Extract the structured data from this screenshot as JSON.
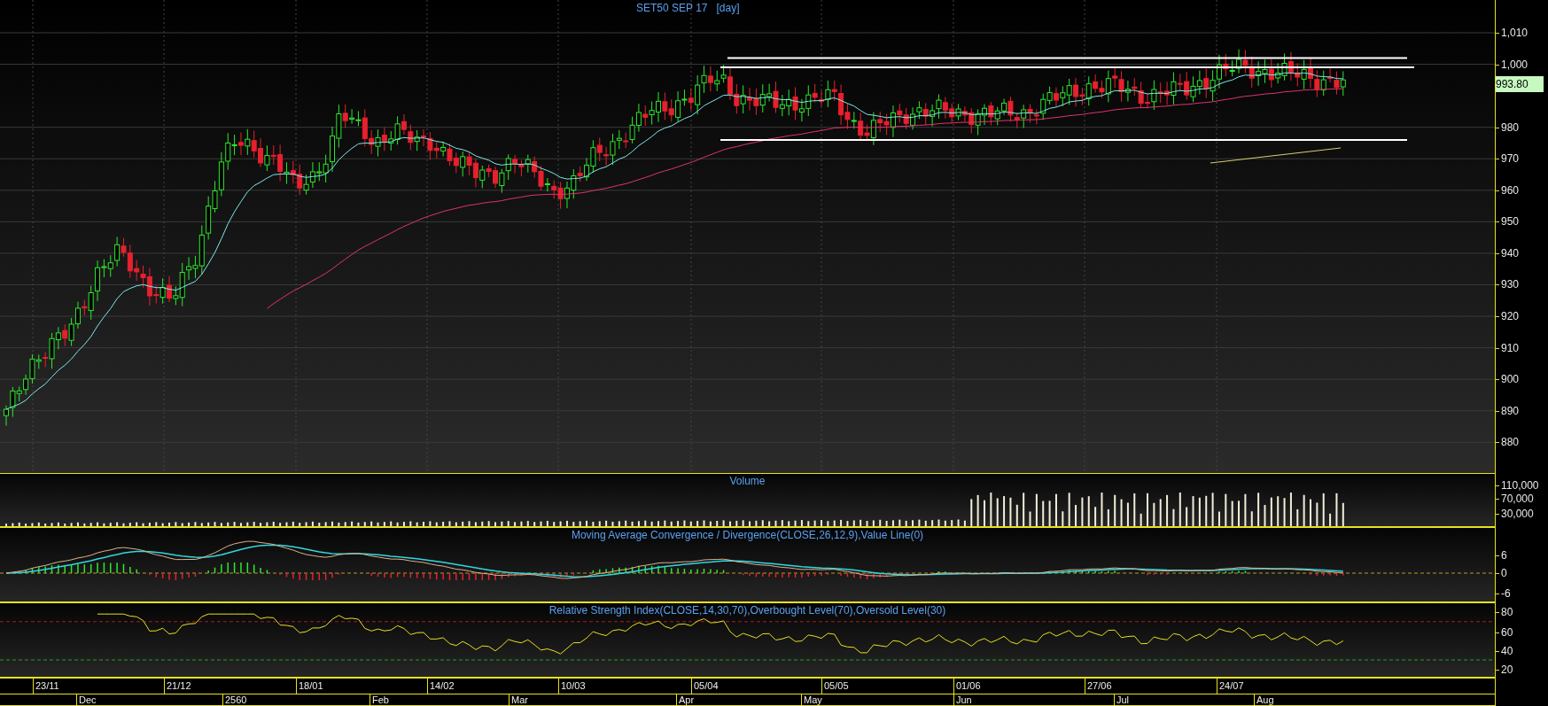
{
  "title": "SET50 SEP 17",
  "period": "[day]",
  "price_axis": {
    "ticks": [
      "1,010",
      "1,000",
      "980",
      "970",
      "960",
      "950",
      "940",
      "930",
      "920",
      "910",
      "900",
      "890",
      "880"
    ],
    "last_price": "993.80"
  },
  "panels": [
    {
      "kind": "volume",
      "title": "Volume",
      "ticks": [
        "110,000",
        "70,000",
        "30,000"
      ]
    },
    {
      "kind": "macd",
      "title": "Moving Average Convergence / Divergence(CLOSE,26,12,9),Value Line(0)",
      "ticks": [
        "6",
        "0",
        "-6"
      ]
    },
    {
      "kind": "rsi",
      "title": "Relative Strength Index(CLOSE,14,30,70),Overbought Level(70),Oversold Level(30)",
      "ticks": [
        "80",
        "60",
        "40",
        "20"
      ]
    }
  ],
  "date_axis": {
    "dates": [
      "23/11",
      "21/12",
      "18/01",
      "14/02",
      "10/03",
      "05/04",
      "05/05",
      "01/06",
      "27/06",
      "24/07"
    ],
    "months": [
      "Dec",
      "2560",
      "Feb",
      "Mar",
      "Apr",
      "May",
      "Jun",
      "Jul",
      "Aug"
    ]
  }
}
